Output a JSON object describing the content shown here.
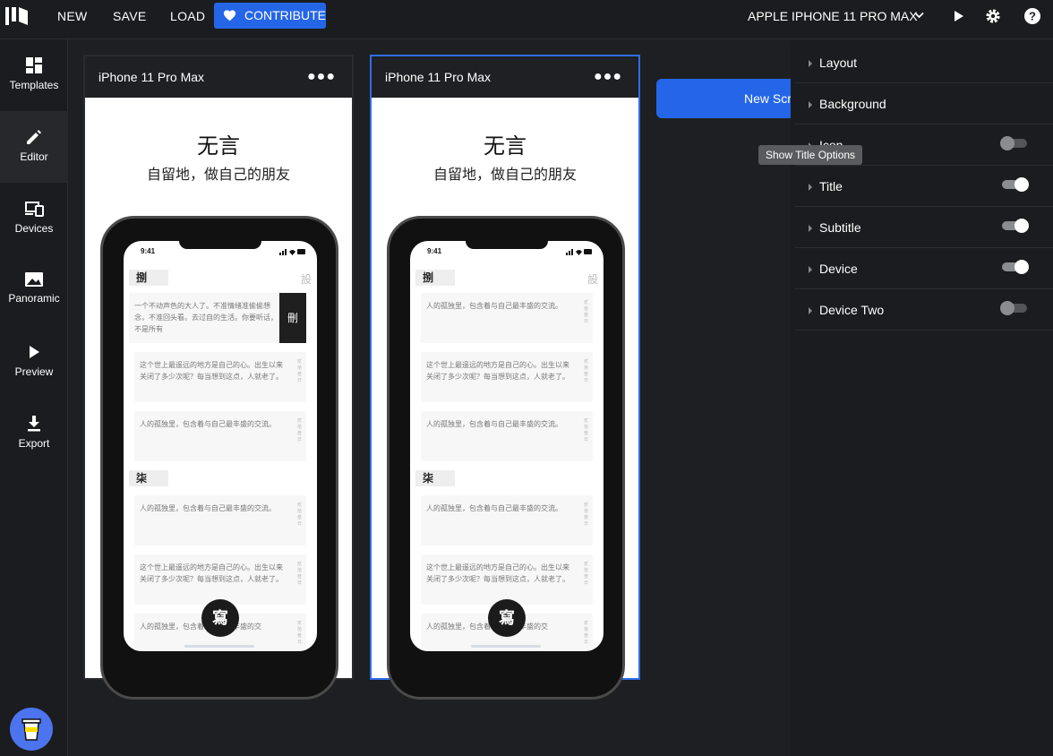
{
  "topbar": {
    "new_label": "NEW",
    "save_label": "SAVE",
    "load_label": "LOAD",
    "contribute_label": "CONTRIBUTE",
    "device_select": "APPLE IPHONE 11 PRO MAX"
  },
  "sidebar": {
    "items": [
      {
        "label": "Templates",
        "icon": "templates-icon"
      },
      {
        "label": "Editor",
        "icon": "pencil-icon"
      },
      {
        "label": "Devices",
        "icon": "devices-icon"
      },
      {
        "label": "Panoramic",
        "icon": "image-icon"
      },
      {
        "label": "Preview",
        "icon": "play-icon"
      },
      {
        "label": "Export",
        "icon": "download-icon"
      }
    ],
    "active": "Editor"
  },
  "canvas": {
    "screens": [
      {
        "name": "iPhone 11 Pro Max",
        "title": "无言",
        "subtitle": "自留地，做自己的朋友",
        "selected": false,
        "phone": {
          "time": "9:41",
          "section1": "捌",
          "settings_label": "設",
          "notes1": [
            "一个不动声色的大人了。不准情绪准偷偷想念，不准回头看。去过自的生活。你要听话，不是所有",
            "这个世上最遥远的地方是自己的心。出生以来关闭了多少次呢？每当想到这点，人就老了。",
            "人的孤独里，包含着与自己最丰盛的交流。"
          ],
          "delete_label": "刪",
          "section2": "柒",
          "notes2": [
            "人的孤独里，包含着与自己最丰盛的交流。",
            "这个世上最遥远的地方是自己的心。出生以来关闭了多少次呢？每当想到这点，人就老了。",
            "人的孤独里，包含着与自己最丰盛的交"
          ],
          "side_text": "贰拾叁日",
          "fab_label": "寫"
        }
      },
      {
        "name": "iPhone 11 Pro Max",
        "title": "无言",
        "subtitle": "自留地，做自己的朋友",
        "selected": true,
        "phone": {
          "time": "9:41",
          "section1": "捌",
          "settings_label": "設",
          "notes1": [
            "人的孤独里，包含着与自己最丰盛的交流。",
            "这个世上最遥远的地方是自己的心。出生以来关闭了多少次呢？每当想到这点，人就老了。",
            "人的孤独里，包含着与自己最丰盛的交流。"
          ],
          "section2": "柒",
          "notes2": [
            "人的孤独里，包含着与自己最丰盛的交流。",
            "这个世上最遥远的地方是自己的心。出生以来关闭了多少次呢？每当想到这点，人就老了。",
            "人的孤独里，包含着与自己最丰盛的交"
          ],
          "side_text": "贰拾叁日",
          "fab_label": "寫"
        }
      }
    ],
    "new_screen_label": "New Screen"
  },
  "panel": {
    "sections": [
      {
        "label": "Layout",
        "toggle": null
      },
      {
        "label": "Background",
        "toggle": null
      },
      {
        "label": "Icon",
        "toggle": false
      },
      {
        "label": "Title",
        "toggle": true
      },
      {
        "label": "Subtitle",
        "toggle": true
      },
      {
        "label": "Device",
        "toggle": true
      },
      {
        "label": "Device Two",
        "toggle": false
      }
    ],
    "tooltip": "Show Title Options"
  },
  "colors": {
    "accent": "#2566e8",
    "background": "#1e1f22",
    "panel": "#1b1c1f"
  }
}
